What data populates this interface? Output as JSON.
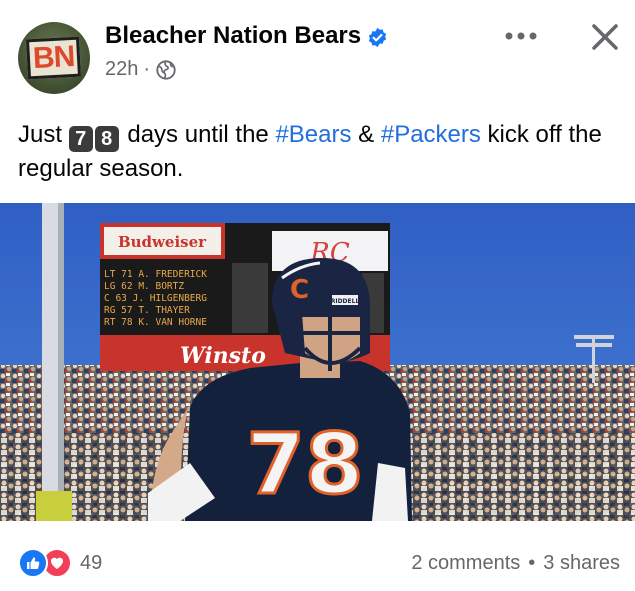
{
  "post": {
    "page_name": "Bleacher Nation Bears",
    "avatar_text": "BN",
    "timestamp": "22h",
    "separator": "·",
    "text_before": "Just ",
    "key_digits": [
      "7",
      "8"
    ],
    "text_mid": " days until the ",
    "hashtag_1": "#Bears",
    "text_amp": " & ",
    "hashtag_2": "#Packers",
    "text_after": " kick off the regular season."
  },
  "photo": {
    "scoreboard_brand": "Budweiser",
    "scoreboard_lines": [
      "LT  71  A. FREDERICK",
      "LG  62  M. BORTZ",
      "C   63  J. HILGENBERG",
      "RG  57  T. THAYER",
      "RT  78  K. VAN HORNE"
    ],
    "sign_text": "Winsto",
    "jersey_number": "78",
    "helmet_brand": "RIDDELL"
  },
  "footer": {
    "reaction_count": "49",
    "comments": "2 comments",
    "dot": "•",
    "shares": "3 shares"
  },
  "colors": {
    "hashtag": "#216fdb",
    "like": "#1877f2",
    "love": "#f33e58",
    "verified": "#1877f2",
    "muted_text": "#65676b"
  },
  "icons": [
    "verified-badge-icon",
    "globe-icon",
    "more-options-icon",
    "close-icon",
    "like-reaction-icon",
    "love-reaction-icon"
  ]
}
